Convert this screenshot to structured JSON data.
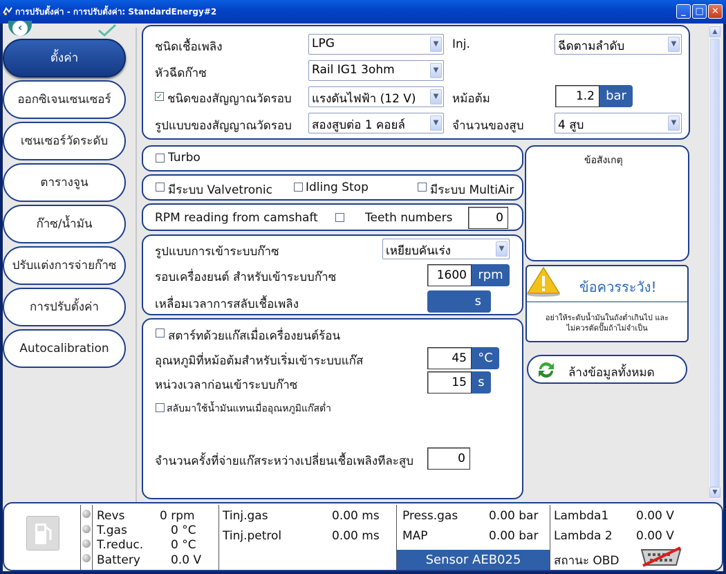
{
  "window": {
    "title": "การปรับตั้งค่า - การปรับตั้งค่า: StandardEnergy#2"
  },
  "sidebar": {
    "items": [
      {
        "label": "ตั้งค่า",
        "active": true
      },
      {
        "label": "ออกซิเจนเซนเซอร์"
      },
      {
        "label": "เซนเซอร์วัดระดับ"
      },
      {
        "label": "ตารางจูน"
      },
      {
        "label": "ก๊าซ/น้ำมัน"
      },
      {
        "label": "ปรับแต่งการจ่ายก๊าซ"
      },
      {
        "label": "การปรับตั้งค่า"
      },
      {
        "label": "Autocalibration"
      }
    ]
  },
  "fuel": {
    "fuel_type_label": "ชนิดเชื้อเพลิง",
    "fuel_type_value": "LPG",
    "injector_label": "หัวฉีดก๊าซ",
    "injector_value": "Rail IG1 3ohm",
    "rpm_signal_label": "ชนิดของสัญญาณวัดรอบ",
    "rpm_signal_checked": true,
    "rpm_signal_value": "แรงดันไฟฟ้า (12 V)",
    "rpm_pattern_label": "รูปแบบของสัญญาณวัดรอบ",
    "rpm_pattern_value": "สองสูบต่อ 1 คอยล์",
    "inj_label": "Inj.",
    "inj_value": "ฉีดตามลำดับ",
    "reducer_label": "หม้อต้ม",
    "reducer_value": "1.2",
    "reducer_unit": "bar",
    "cylinders_label": "จำนวนของสูบ",
    "cylinders_value": "4 สูบ"
  },
  "turbo": {
    "label": "Turbo",
    "checked": false
  },
  "options": {
    "valvetronic": "มีระบบ Valvetronic",
    "idling": "Idling Stop",
    "multiair": "มีระบบ MultiAir"
  },
  "camshaft": {
    "label": "RPM reading from camshaft",
    "teeth_label": "Teeth numbers",
    "teeth_value": "0"
  },
  "switchover": {
    "mode_label": "รูปแบบการเข้าระบบก๊าซ",
    "mode_value": "เหยียบคันเร่ง",
    "rpm_label": "รอบเครื่องยนต์ สำหรับเข้าระบบก๊าซ",
    "rpm_value": "1600",
    "rpm_unit": "rpm",
    "overlap_label": "เหลื่อมเวลาการสลับเชื้อเพลิง",
    "overlap_value": "",
    "overlap_unit": "s"
  },
  "start": {
    "hot_start_label": "สตาร์ทด้วยแก๊สเมื่อเครื่องยนต์ร้อน",
    "temp_label": "อุณหภูมิที่หม้อต้มสำหรับเริ่มเข้าระบบแก๊ส",
    "temp_value": "45",
    "temp_unit": "°C",
    "delay_label": "หน่วงเวลาก่อนเข้าระบบก๊าซ",
    "delay_value": "15",
    "delay_unit": "s",
    "petrol_fallback_label": "สลับมาใช้น้ำมันแทนเมื่ออุณหภูมิแก๊สต่ำ",
    "injections_label": "จำนวนครั้งที่จ่ายแก๊สระหว่างเปลี่ยนเชื้อเพลิงทีละสูบ",
    "injections_value": "0"
  },
  "notes": {
    "title": "ข้อสังเกตุ"
  },
  "warning": {
    "title": "ข้อควรระวัง!",
    "text_line1": "อย่าให้ระดับน้ำมันในถังต่ำเกินไป และ",
    "text_line2": "ไม่ควรตัดปั๊มถ้าไม่จำเป็น"
  },
  "clear_button": {
    "label": "ล้างข้อมูลทั้งหมด"
  },
  "status": {
    "revs_label": "Revs",
    "revs_value": "0 rpm",
    "tgas_label": "T.gas",
    "tgas_value": "0 °C",
    "treduc_label": "T.reduc.",
    "treduc_value": "0 °C",
    "battery_label": "Battery",
    "battery_value": "0.0 V",
    "tinj_gas_label": "Tinj.gas",
    "tinj_gas_value": "0.00 ms",
    "tinj_petrol_label": "Tinj.petrol",
    "tinj_petrol_value": "0.00 ms",
    "press_gas_label": "Press.gas",
    "press_gas_value": "0.00 bar",
    "map_label": "MAP",
    "map_value": "0.00 bar",
    "sensor_label": "Sensor AEB025",
    "lambda1_label": "Lambda1",
    "lambda1_value": "0.00 V",
    "lambda2_label": "Lambda 2",
    "lambda2_value": "0.00 V",
    "obd_label": "สถานะ OBD"
  },
  "colors": {
    "accent": "#2f5fa8",
    "border": "#1f3f8c",
    "title_bar": "#0344c8"
  }
}
